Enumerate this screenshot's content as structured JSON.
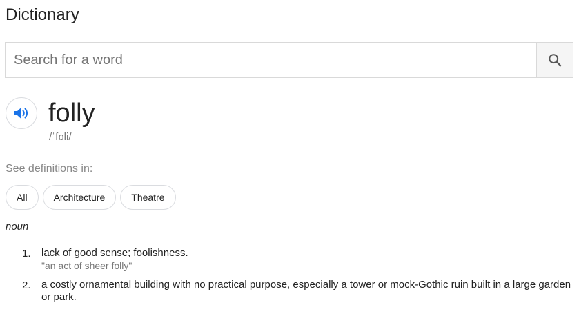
{
  "header": {
    "title": "Dictionary"
  },
  "search": {
    "placeholder": "Search for a word",
    "value": "",
    "button_icon": "search-icon"
  },
  "entry": {
    "speaker_icon": "speaker-icon",
    "word": "folly",
    "phonetic": "/ˈfɒli/"
  },
  "filters": {
    "heading": "See definitions in:",
    "chips": [
      "All",
      "Architecture",
      "Theatre"
    ]
  },
  "definitions": {
    "part_of_speech": "noun",
    "items": [
      {
        "number": "1.",
        "text": "lack of good sense; foolishness.",
        "example": "\"an act of sheer folly\""
      },
      {
        "number": "2.",
        "text": "a costly ornamental building with no practical purpose, especially a tower or mock-Gothic ruin built in a large garden or park."
      }
    ]
  },
  "colors": {
    "accent_blue": "#1a73e8",
    "muted_text": "#777777",
    "border": "#dadce0"
  }
}
